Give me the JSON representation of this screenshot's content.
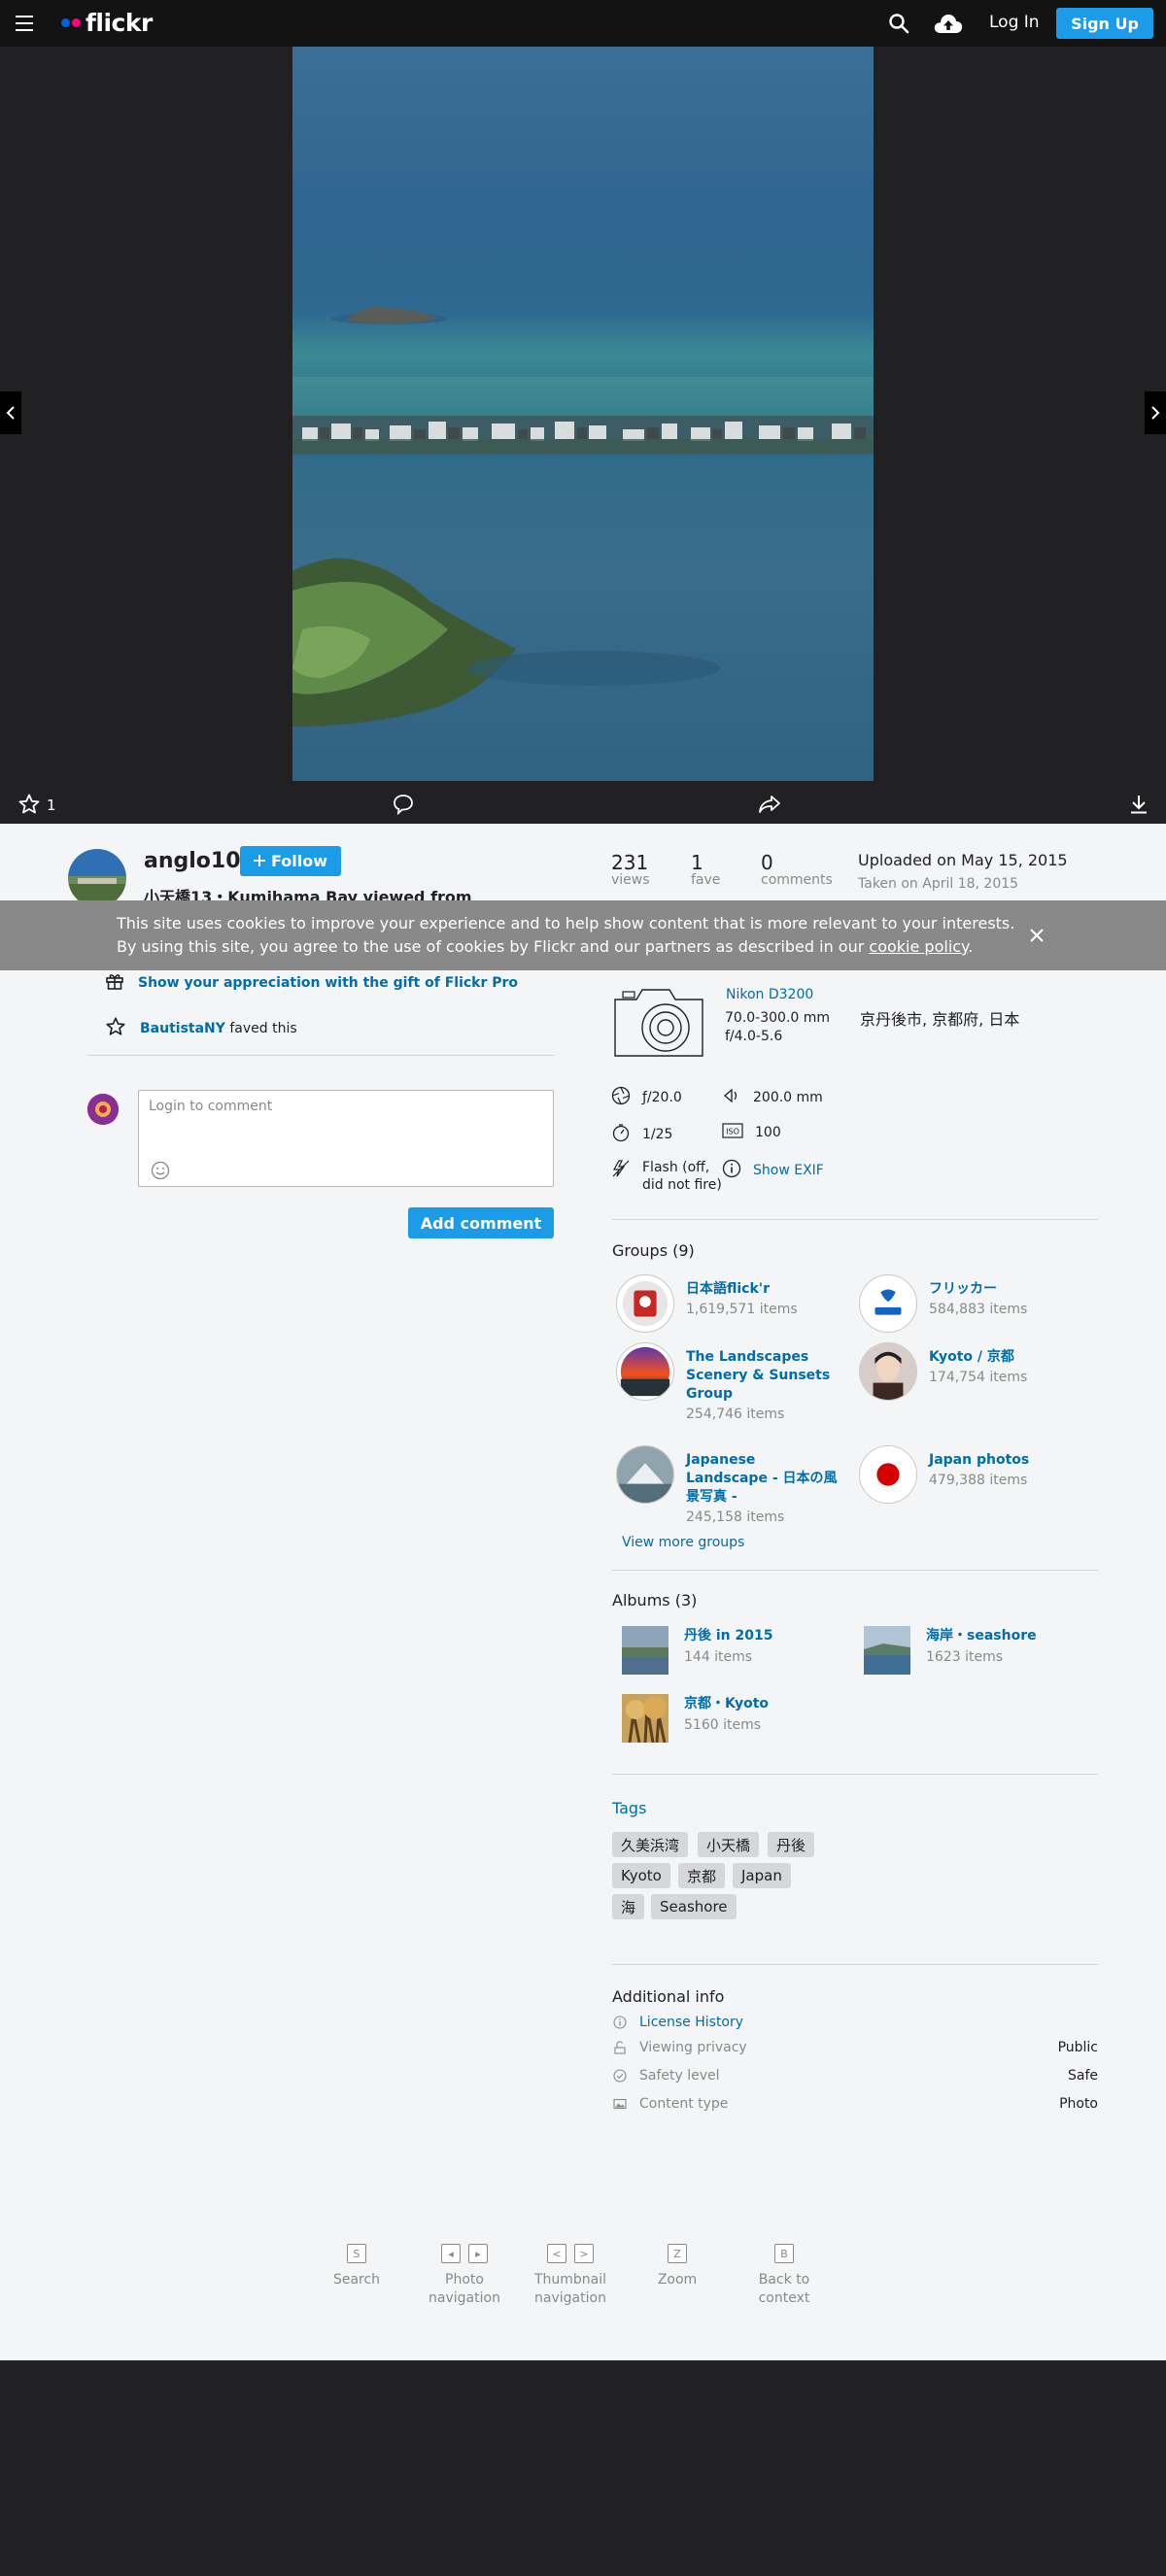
{
  "nav": {
    "brand": "flickr",
    "login": "Log In",
    "signup": "Sign Up"
  },
  "stage": {
    "fave_count": "1"
  },
  "owner": {
    "name": "anglo10",
    "follow": "Follow"
  },
  "photo": {
    "title": "小天橋13・Kumihama Bay viewed from"
  },
  "stats": {
    "views": "231",
    "views_label": "views",
    "faves": "1",
    "faves_label": "fave",
    "comments": "0",
    "comments_label": "comments",
    "uploaded": "Uploaded on May 15, 2015",
    "taken": "Taken on April 18, 2015"
  },
  "cookie": {
    "text_before": "This site uses cookies to improve your experience and to help show content that is more relevant to your interests. By using this site, you agree to the use of cookies by Flickr and our partners as described in our",
    "link": "cookie policy",
    "text_after": "."
  },
  "appreciation": {
    "gift": "Show your appreciation with the gift of Flickr Pro",
    "faver": "BautistaNY",
    "faved": "faved this"
  },
  "comment": {
    "placeholder": "Login to comment",
    "add": "Add comment"
  },
  "camera": {
    "name": "Nikon D3200",
    "lens": "70.0-300.0 mm",
    "aperture_range": "f/4.0-5.6",
    "location": "京丹後市, 京都府, 日本"
  },
  "exif": {
    "aperture": "ƒ/20.0",
    "focal": "200.0 mm",
    "shutter": "1/25",
    "iso": "100",
    "flash": "Flash (off, did not fire)",
    "show": "Show EXIF"
  },
  "groups": {
    "title": "Groups (9)",
    "items": [
      {
        "name": "日本語flick'r",
        "count": "1,619,571 items"
      },
      {
        "name": "フリッカー",
        "count": "584,883 items"
      },
      {
        "name": "The Landscapes Scenery & Sunsets Group",
        "count": "254,746 items"
      },
      {
        "name": "Kyoto / 京都",
        "count": "174,754 items"
      },
      {
        "name": "Japanese Landscape - 日本の風景写真 -",
        "count": "245,158 items"
      },
      {
        "name": "Japan photos",
        "count": "479,388 items"
      }
    ],
    "view_more": "View more groups"
  },
  "albums": {
    "title": "Albums (3)",
    "items": [
      {
        "name": "丹後 in 2015",
        "count": "144 items"
      },
      {
        "name": "海岸・seashore",
        "count": "1623 items"
      },
      {
        "name": "京都・Kyoto",
        "count": "5160 items"
      }
    ]
  },
  "tags": {
    "title": "Tags",
    "items": [
      "久美浜湾",
      "小天橋",
      "丹後",
      "Kyoto",
      "京都",
      "Japan",
      "海",
      "Seashore"
    ]
  },
  "info": {
    "title": "Additional info",
    "license": "License History",
    "privacy_label": "Viewing privacy",
    "privacy_value": "Public",
    "safety_label": "Safety level",
    "safety_value": "Safe",
    "content_label": "Content type",
    "content_value": "Photo"
  },
  "shortcuts": [
    {
      "keys": [
        "S"
      ],
      "label1": "Search",
      "label2": ""
    },
    {
      "keys": [
        "◂",
        "▸"
      ],
      "label1": "Photo",
      "label2": "navigation"
    },
    {
      "keys": [
        "<",
        ">"
      ],
      "label1": "Thumbnail",
      "label2": "navigation"
    },
    {
      "keys": [
        "Z"
      ],
      "label1": "Zoom",
      "label2": ""
    },
    {
      "keys": [
        "B"
      ],
      "label1": "Back to",
      "label2": "context"
    }
  ],
  "colors": {
    "accent": "#1c9be9",
    "link": "#006dac",
    "nav_bg": "#131314",
    "content_bg": "#f3f5f6"
  }
}
